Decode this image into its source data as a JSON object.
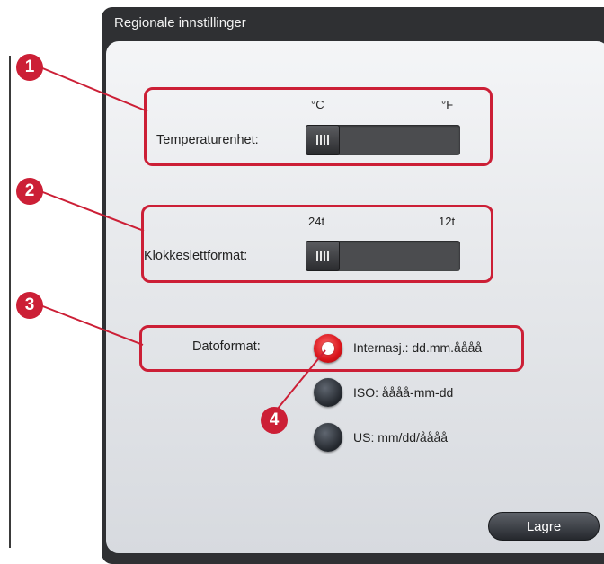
{
  "dialog": {
    "title": "Regionale innstillinger",
    "save_label": "Lagre"
  },
  "temperature": {
    "label": "Temperaturenhet:",
    "left_option": "°C",
    "right_option": "°F",
    "selected": "°C"
  },
  "clock": {
    "label": "Klokkeslettformat:",
    "left_option": "24t",
    "right_option": "12t",
    "selected": "24t"
  },
  "date": {
    "label": "Datoformat:",
    "options": [
      {
        "label": "Internasj.: dd.mm.åååå",
        "selected": true
      },
      {
        "label": "ISO: åååå-mm-dd",
        "selected": false
      },
      {
        "label": "US: mm/dd/åååå",
        "selected": false
      }
    ]
  },
  "callouts": [
    "1",
    "2",
    "3",
    "4"
  ],
  "colors": {
    "callout": "#cc1f36",
    "selected_radio": "#d9141b",
    "title_bar": "#2f3033"
  }
}
